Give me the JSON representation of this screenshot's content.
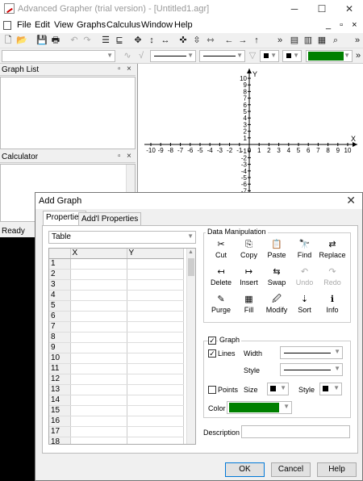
{
  "app": {
    "title": "Advanced Grapher (trial version) - [Untitled1.agr]",
    "min": "─",
    "max": "☐",
    "close": "✕"
  },
  "menu": [
    "File",
    "Edit",
    "View",
    "Graphs",
    "Calculus",
    "Window",
    "Help"
  ],
  "menu_right": "_ ▫ ×",
  "panels": {
    "graph_list": "Graph List",
    "calculator": "Calculator",
    "restore": "▫",
    "close": "×"
  },
  "status": "Ready",
  "plot": {
    "x_ticks": [
      "-10",
      "-9",
      "-8",
      "-7",
      "-6",
      "-5",
      "-4",
      "-3",
      "-2",
      "-1",
      "0",
      "1",
      "2",
      "3",
      "4",
      "5",
      "6",
      "7",
      "8",
      "9",
      "10"
    ],
    "y_ticks": [
      "10",
      "9",
      "8",
      "7",
      "6",
      "5",
      "4",
      "3",
      "2",
      "1"
    ],
    "y_neg": [
      "-1",
      "-2",
      "-3",
      "-4",
      "-5",
      "-6",
      "-7"
    ],
    "x_axis": "X",
    "y_axis": "Y"
  },
  "dialog": {
    "title": "Add Graph",
    "close": "✕",
    "tabs": [
      "Properties",
      "Add'l Properties"
    ],
    "type": "Table",
    "columns": [
      "X",
      "Y"
    ],
    "rows": [
      "1",
      "2",
      "3",
      "4",
      "5",
      "6",
      "7",
      "8",
      "9",
      "10",
      "11",
      "12",
      "13",
      "14",
      "15",
      "16",
      "17",
      "18"
    ],
    "dm_label": "Data Manipulation",
    "dm": [
      [
        {
          "label": "Cut",
          "icon": "✂"
        },
        {
          "label": "Copy",
          "icon": "⎘"
        },
        {
          "label": "Paste",
          "icon": "📋"
        },
        {
          "label": "Find",
          "icon": "🔭"
        },
        {
          "label": "Replace",
          "icon": "⇄"
        }
      ],
      [
        {
          "label": "Delete",
          "icon": "↤"
        },
        {
          "label": "Insert",
          "icon": "↦"
        },
        {
          "label": "Swap",
          "icon": "⇆"
        },
        {
          "label": "Undo",
          "icon": "↶"
        },
        {
          "label": "Redo",
          "icon": "↷"
        }
      ],
      [
        {
          "label": "Purge",
          "icon": "✎"
        },
        {
          "label": "Fill",
          "icon": "▦"
        },
        {
          "label": "Modify",
          "icon": "🖉"
        },
        {
          "label": "Sort",
          "icon": "⇣"
        },
        {
          "label": "Info",
          "icon": "ℹ"
        }
      ]
    ],
    "graph_label": "Graph",
    "lines_label": "Lines",
    "width_label": "Width",
    "style_label": "Style",
    "points_label": "Points",
    "size_label": "Size",
    "style2_label": "Style",
    "color_label": "Color",
    "color": "#008000",
    "description_label": "Description",
    "description": "",
    "ok": "OK",
    "cancel": "Cancel",
    "help": "Help"
  }
}
